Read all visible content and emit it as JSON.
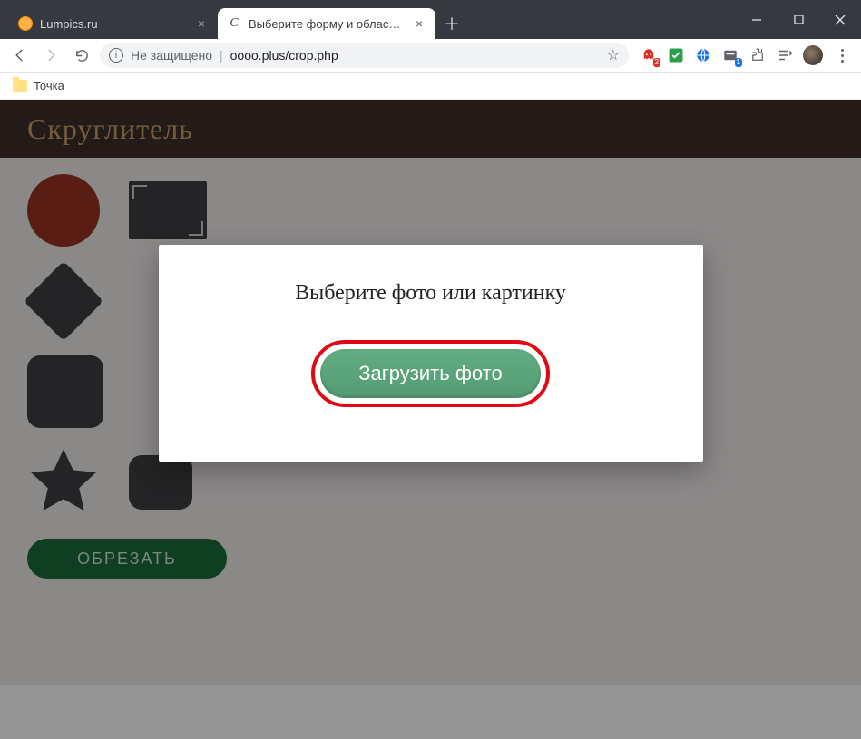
{
  "window": {
    "tabs": [
      {
        "title": "Lumpics.ru",
        "active": false
      },
      {
        "title": "Выберите форму и область для",
        "active": true
      }
    ]
  },
  "toolbar": {
    "security_label": "Не защищено",
    "url": "oooo.plus/crop.php",
    "ext_ghostery_badge": "2",
    "ext_idm_badge": "1"
  },
  "bookmarks": {
    "item1": "Точка"
  },
  "page": {
    "brand": "Скруглитель",
    "crop_button": "ОБРЕЗАТЬ"
  },
  "modal": {
    "title": "Выберите фото или картинку",
    "upload_label": "Загрузить фото"
  }
}
